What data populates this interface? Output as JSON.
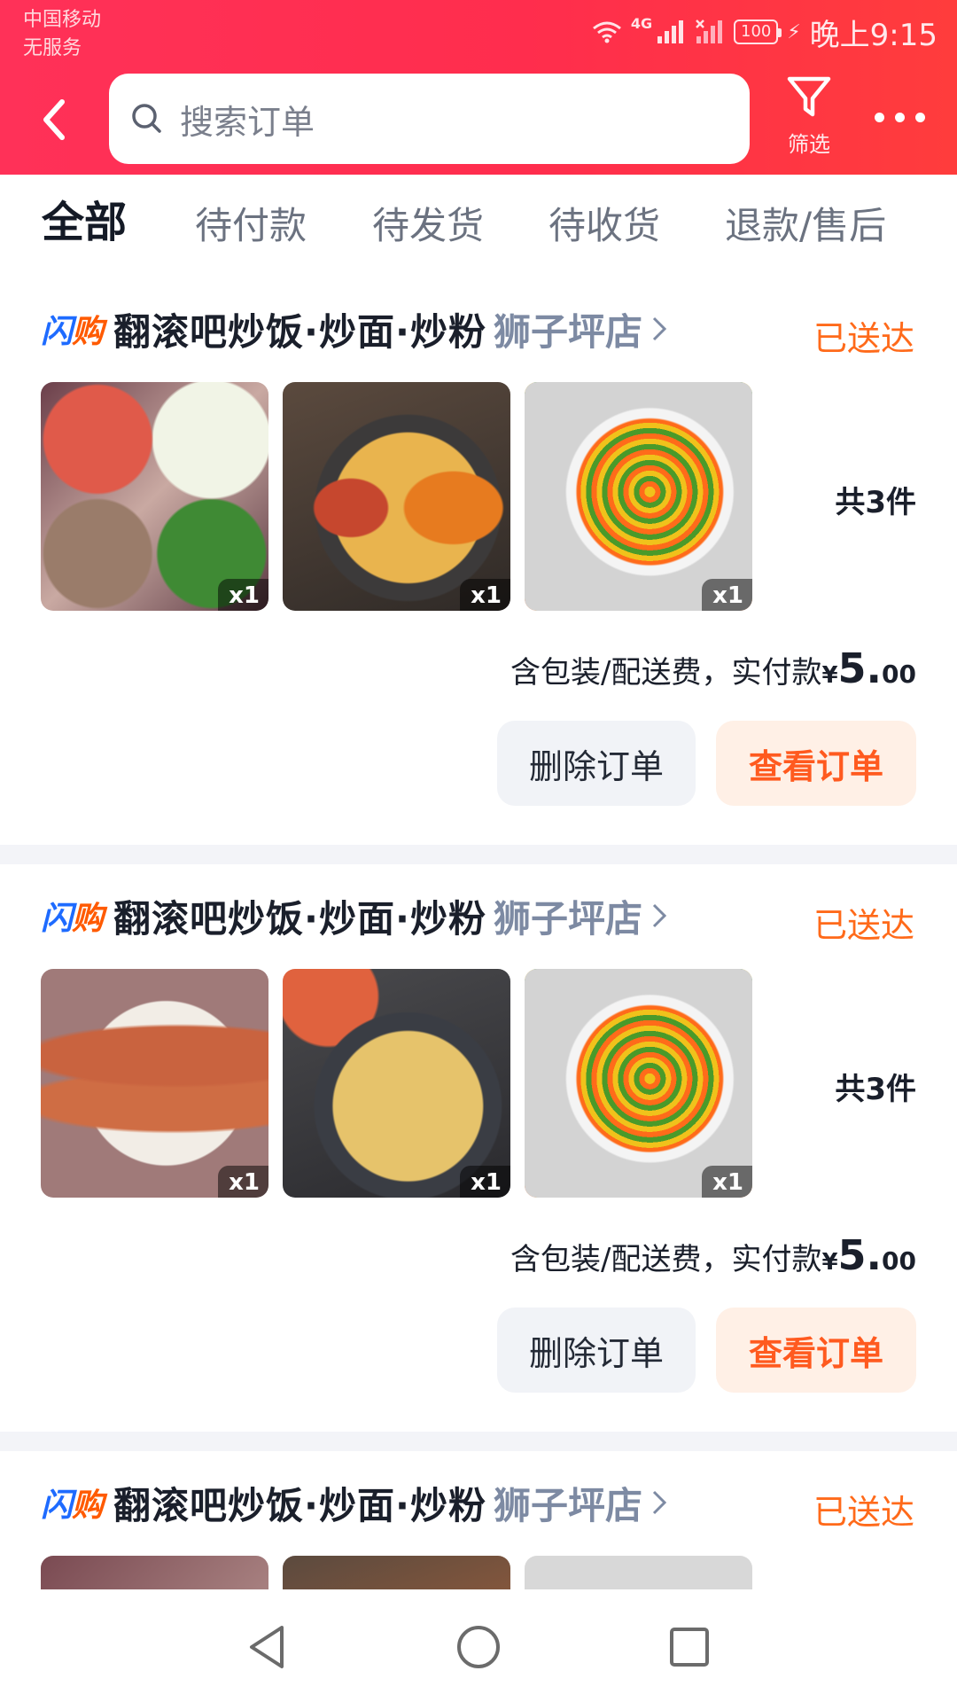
{
  "status_bar": {
    "carrier": "中国移动",
    "service": "无服务",
    "network": "4G",
    "battery": "100",
    "time": "晚上9:15"
  },
  "search": {
    "placeholder": "搜索订单"
  },
  "filter": {
    "label": "筛选"
  },
  "tabs": [
    "全部",
    "待付款",
    "待发货",
    "待收货",
    "退款/售后"
  ],
  "orders": [
    {
      "logo": "闪购",
      "shop": "翻滚吧炒饭·炒面·炒粉",
      "branch": "狮子坪店",
      "status": "已送达",
      "items": [
        {
          "icon": "ingredients-food-image",
          "qty": "x1"
        },
        {
          "icon": "fried-rice-sausage-image",
          "qty": "x1"
        },
        {
          "icon": "mixed-vegetables-image",
          "qty": "x1"
        }
      ],
      "count": "共3件",
      "pay_label": "含包装/配送费，实付款",
      "currency": "¥",
      "amount_int": "5.",
      "amount_dec": "00",
      "delete_label": "删除订单",
      "view_label": "查看订单"
    },
    {
      "logo": "闪购",
      "shop": "翻滚吧炒饭·炒面·炒粉",
      "branch": "狮子坪店",
      "status": "已送达",
      "items": [
        {
          "icon": "sausages-image",
          "qty": "x1"
        },
        {
          "icon": "fried-rice-image",
          "qty": "x1"
        },
        {
          "icon": "mixed-vegetables-image",
          "qty": "x1"
        }
      ],
      "count": "共3件",
      "pay_label": "含包装/配送费，实付款",
      "currency": "¥",
      "amount_int": "5.",
      "amount_dec": "00",
      "delete_label": "删除订单",
      "view_label": "查看订单"
    },
    {
      "logo": "闪购",
      "shop": "翻滚吧炒饭·炒面·炒粉",
      "branch": "狮子坪店",
      "status": "已送达"
    }
  ],
  "colors": {
    "header": "#ff2d4d",
    "accent_orange": "#ff5a1f",
    "status_orange": "#ff6a1a",
    "branch_gray": "#7d8aa3"
  }
}
